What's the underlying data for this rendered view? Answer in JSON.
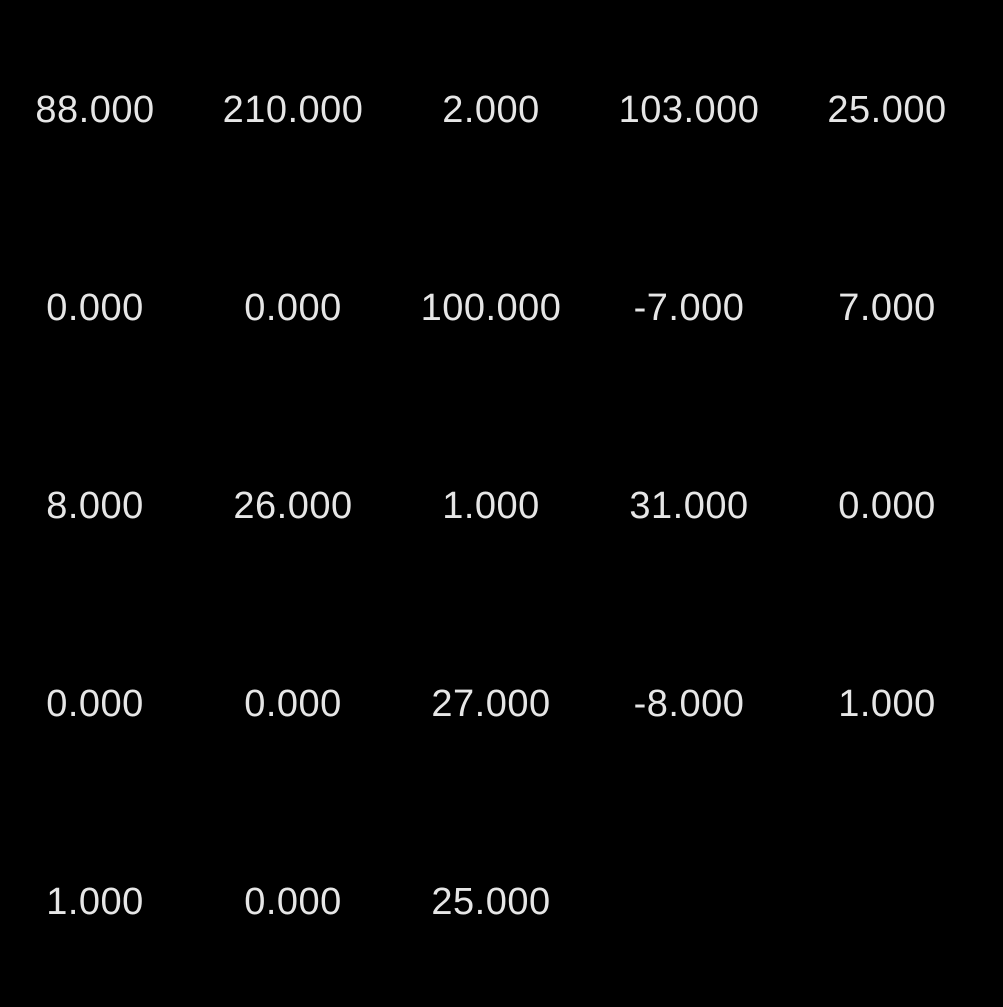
{
  "theme": {
    "background": "#000000",
    "text": "#e6e6e6"
  },
  "grid": {
    "rows": [
      [
        "88.000",
        "210.000",
        "2.000",
        "103.000",
        "25.000"
      ],
      [
        "0.000",
        "0.000",
        "100.000",
        "-7.000",
        "7.000"
      ],
      [
        "8.000",
        "26.000",
        "1.000",
        "31.000",
        "0.000"
      ],
      [
        "0.000",
        "0.000",
        "27.000",
        "-8.000",
        "1.000"
      ],
      [
        "1.000",
        "0.000",
        "25.000"
      ]
    ]
  }
}
